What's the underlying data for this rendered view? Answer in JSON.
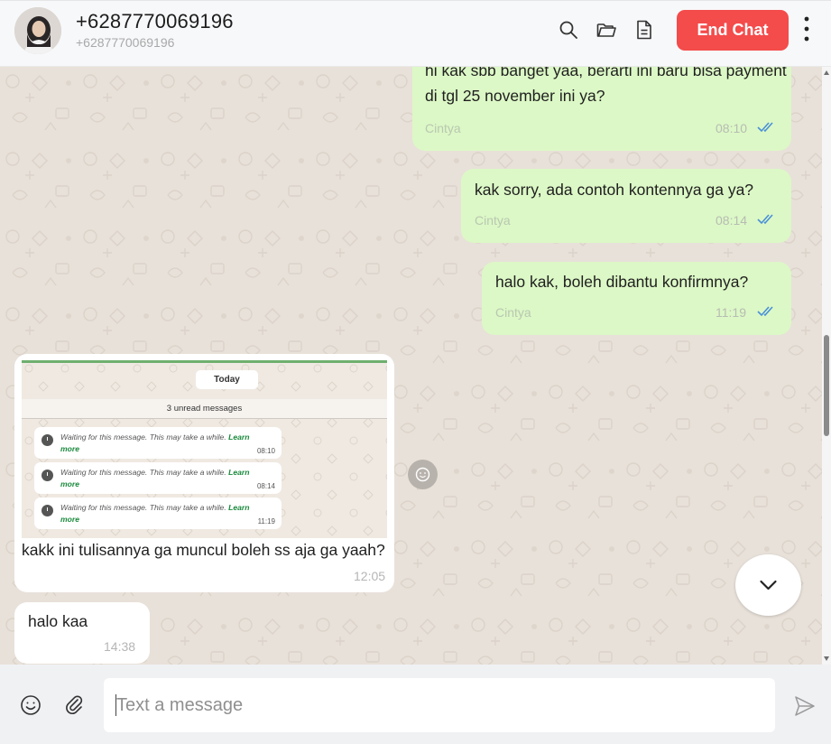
{
  "header": {
    "contact_name": "+6287770069196",
    "contact_number": "+6287770069196",
    "end_chat_label": "End Chat",
    "icons": [
      "search-icon",
      "folder-open-icon",
      "document-icon",
      "kebab-menu-icon"
    ]
  },
  "messages": [
    {
      "direction": "out",
      "lines": [
        "hi kak sbb banget yaa, berarti ini baru bisa payment",
        "di tgl 25 november ini ya?"
      ],
      "sender": "Cintya",
      "time": "08:10",
      "status": "read"
    },
    {
      "direction": "out",
      "lines": [
        "kak sorry, ada contoh kontennya ga ya?"
      ],
      "sender": "Cintya",
      "time": "08:14",
      "status": "read"
    },
    {
      "direction": "out",
      "lines": [
        "halo kak, boleh dibantu konfirmnya?"
      ],
      "sender": "Cintya",
      "time": "11:19",
      "status": "read"
    },
    {
      "direction": "in",
      "has_image": true,
      "lines": [
        "kakk ini tulisannya ga muncul boleh ss aja ga yaah?"
      ],
      "time": "12:05"
    },
    {
      "direction": "in",
      "lines": [
        "halo kaa"
      ],
      "time": "14:38"
    }
  ],
  "image_preview": {
    "today_label": "Today",
    "unread_label": "3 unread messages",
    "waiting_text": "Waiting for this message. This may take a while.",
    "learn_first": "Learn",
    "learn_second": "more",
    "times": [
      "08:10",
      "08:14",
      "11:19"
    ]
  },
  "composer": {
    "placeholder": "Text a message",
    "icons": [
      "emoji-icon",
      "attach-icon",
      "send-icon"
    ]
  },
  "colors": {
    "end_chat": "#f44b4b",
    "outgoing_bubble": "#dcf8c6",
    "incoming_bubble": "#ffffff",
    "chat_background": "#e8e1d9",
    "read_tick": "#4a90d9"
  }
}
